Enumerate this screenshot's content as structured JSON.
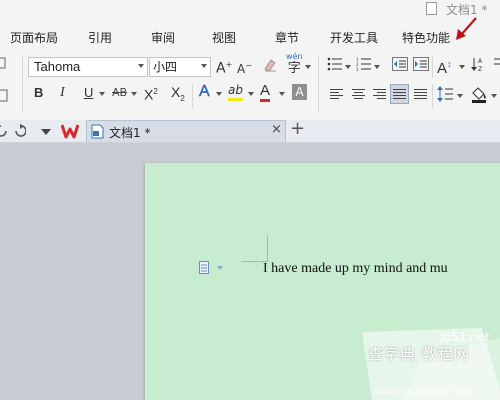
{
  "window": {
    "title": "文档1 *"
  },
  "menu": {
    "tabs": [
      {
        "label": "页面布局"
      },
      {
        "label": "引用"
      },
      {
        "label": "审阅"
      },
      {
        "label": "视图"
      },
      {
        "label": "章节"
      },
      {
        "label": "开发工具"
      },
      {
        "label": "特色功能"
      }
    ]
  },
  "ribbon": {
    "font_name": "Tahoma",
    "font_size": "小四",
    "pinyin_label": "wén",
    "pinyin_char": "字",
    "bold": "B",
    "italic": "I",
    "underline": "U",
    "strikethrough": "AB",
    "superscript_base": "X",
    "superscript_exp": "2",
    "subscript_base": "X",
    "subscript_exp": "2",
    "text_effect": "A",
    "highlight": "ab",
    "font_color": "A",
    "char_shading": "A",
    "grow_font": "A",
    "shrink_font": "A",
    "text_direction": "A"
  },
  "tabbar": {
    "document_tab_label": "文档1 *"
  },
  "document": {
    "body_text": "I have made up my mind and mu"
  },
  "watermark": {
    "site": "jb51.net",
    "name": "查字典 教程网",
    "url": "jiaocheng.chazidian.com"
  },
  "colors": {
    "page_background": "#c8ecd0",
    "annotation_arrow": "#c0141b",
    "wps_logo": "#d9262b"
  }
}
